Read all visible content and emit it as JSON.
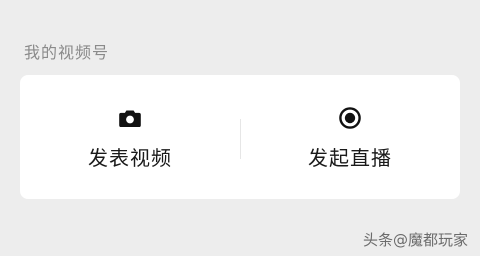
{
  "section": {
    "title": "我的视频号"
  },
  "actions": [
    {
      "label": "发表视频",
      "icon": "camera-icon"
    },
    {
      "label": "发起直播",
      "icon": "live-broadcast-icon"
    }
  ],
  "watermark": {
    "text": "头条@魔都玩家"
  },
  "colors": {
    "background": "#ededed",
    "card": "#ffffff",
    "text": "#1a1a1a",
    "muted": "#8a8a8a"
  }
}
